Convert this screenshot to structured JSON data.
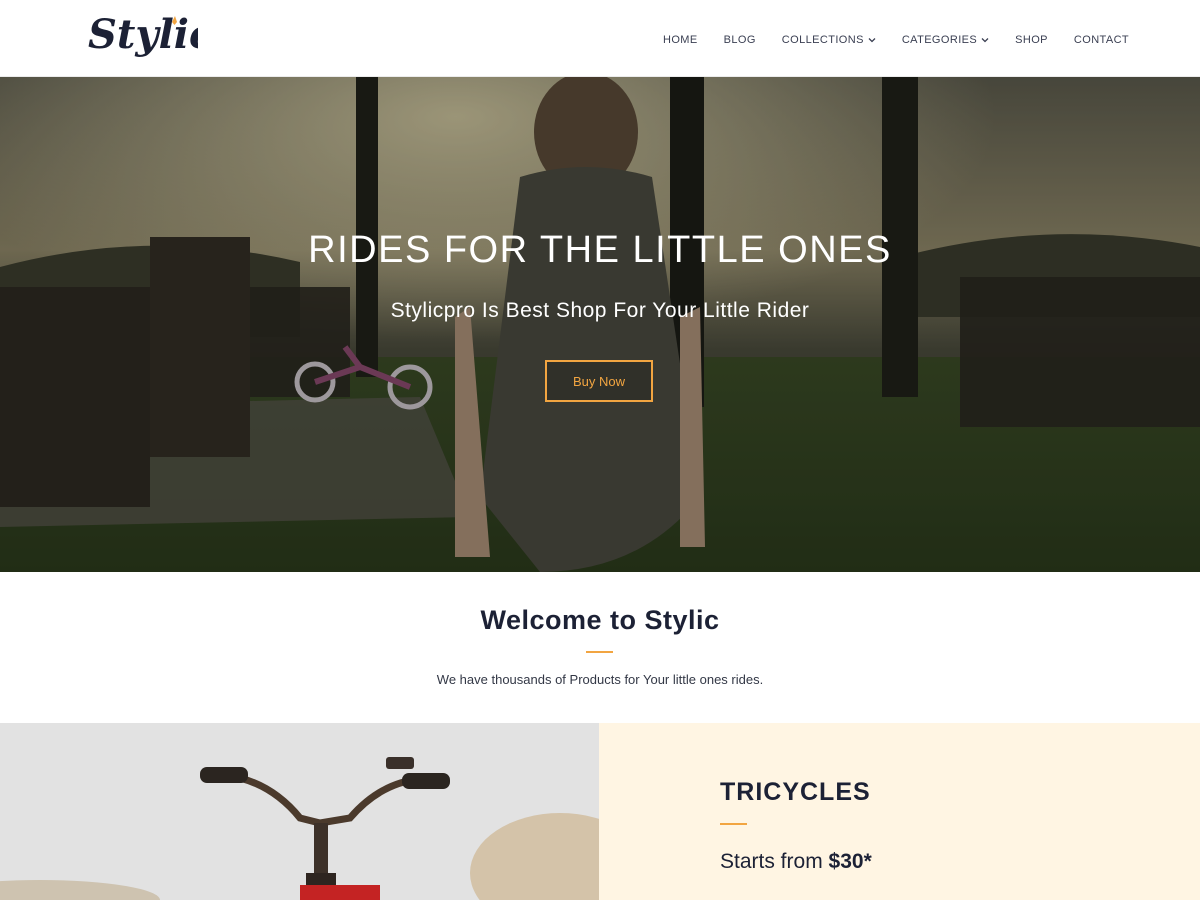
{
  "brand": {
    "logo_text": "Stylic",
    "accent": "#f2a541",
    "ink": "#1c2135"
  },
  "nav": {
    "items": [
      {
        "label": "HOME",
        "dropdown": false
      },
      {
        "label": "BLOG",
        "dropdown": false
      },
      {
        "label": "COLLECTIONS",
        "dropdown": true
      },
      {
        "label": "CATEGORIES",
        "dropdown": true
      },
      {
        "label": "SHOP",
        "dropdown": false
      },
      {
        "label": "CONTACT",
        "dropdown": false
      }
    ]
  },
  "hero": {
    "title": "RIDES FOR THE LITTLE ONES",
    "subtitle": "Stylicpro Is Best Shop For Your Little Rider",
    "button_label": "Buy Now"
  },
  "welcome": {
    "title": "Welcome to Stylic",
    "text": "We have thousands of Products for Your little ones rides."
  },
  "feature": {
    "title": "TRICYCLES",
    "price_prefix": "Starts from",
    "price": "$30*",
    "panel_color": "#fff5e3"
  }
}
